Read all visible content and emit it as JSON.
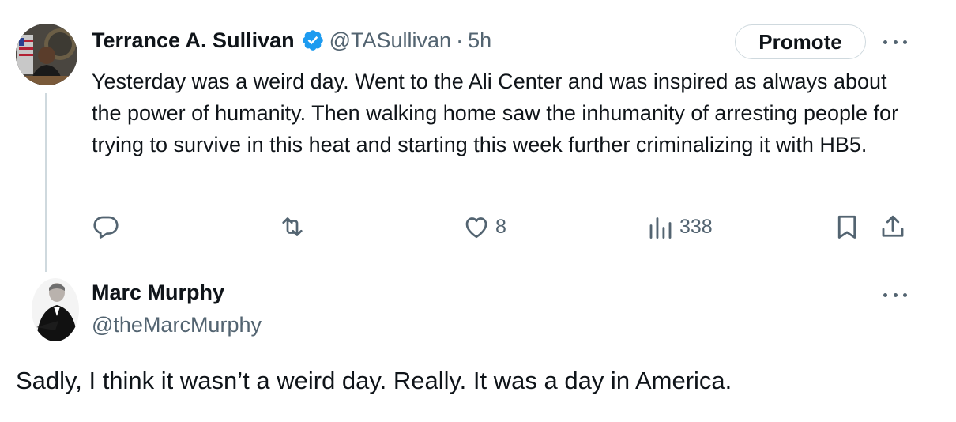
{
  "tweet": {
    "author_name": "Terrance A. Sullivan",
    "handle": "@TASullivan",
    "separator": "·",
    "time": "5h",
    "promote_label": "Promote",
    "text": "Yesterday was a weird day. Went to the Ali Center and was inspired as always about the power of humanity. Then walking home saw the inhumanity of arresting people for trying to survive in this heat and starting this week further criminalizing it with HB5.",
    "actions": {
      "reply_count": "",
      "retweet_count": "",
      "like_count": "8",
      "view_count": "338"
    },
    "icons": [
      "verified-badge-icon",
      "reply-icon",
      "retweet-icon",
      "like-icon",
      "views-icon",
      "bookmark-icon",
      "share-icon",
      "more-icon"
    ]
  },
  "reply": {
    "author_name": "Marc Murphy",
    "handle": "@theMarcMurphy",
    "text": "Sadly, I think it wasn’t a weird day. Really. It was a day in America."
  },
  "colors": {
    "verified_blue": "#1d9bf0",
    "secondary_text": "#536471",
    "primary_text": "#0f1419",
    "thread_line": "#cfd9de"
  }
}
